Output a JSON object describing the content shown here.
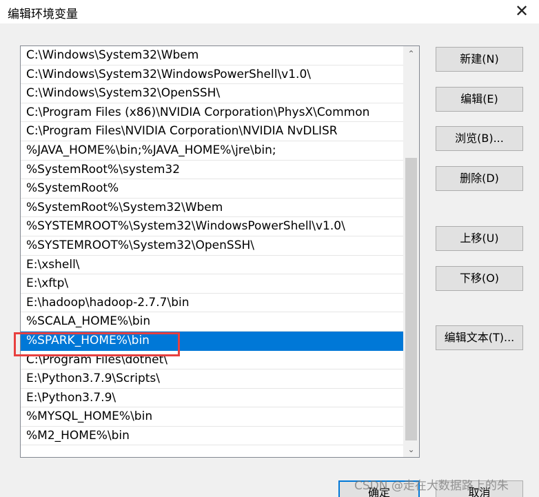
{
  "window": {
    "title": "编辑环境变量",
    "close_glyph": "✕"
  },
  "path_list": {
    "items": [
      "C:\\Windows\\System32\\Wbem",
      "C:\\Windows\\System32\\WindowsPowerShell\\v1.0\\",
      "C:\\Windows\\System32\\OpenSSH\\",
      "C:\\Program Files (x86)\\NVIDIA Corporation\\PhysX\\Common",
      "C:\\Program Files\\NVIDIA Corporation\\NVIDIA NvDLISR",
      "%JAVA_HOME%\\bin;%JAVA_HOME%\\jre\\bin;",
      "%SystemRoot%\\system32",
      "%SystemRoot%",
      "%SystemRoot%\\System32\\Wbem",
      "%SYSTEMROOT%\\System32\\WindowsPowerShell\\v1.0\\",
      "%SYSTEMROOT%\\System32\\OpenSSH\\",
      "E:\\xshell\\",
      "E:\\xftp\\",
      "E:\\hadoop\\hadoop-2.7.7\\bin",
      "%SCALA_HOME%\\bin",
      "%SPARK_HOME%\\bin",
      "C:\\Program Files\\dotnet\\",
      "E:\\Python3.7.9\\Scripts\\",
      "E:\\Python3.7.9\\",
      "%MYSQL_HOME%\\bin",
      "%M2_HOME%\\bin"
    ],
    "selected_index": 15,
    "scroll_up_glyph": "⌃",
    "scroll_down_glyph": "⌄"
  },
  "buttons": {
    "new": "新建(N)",
    "edit": "编辑(E)",
    "browse": "浏览(B)...",
    "delete": "删除(D)",
    "move_up": "上移(U)",
    "move_down": "下移(O)",
    "edit_text": "编辑文本(T)...",
    "ok": "确定",
    "cancel": "取消"
  },
  "watermark": "CSDN @走在大数据路上的朱",
  "colors": {
    "selection": "#0078d7",
    "highlight_box": "#e8403f"
  }
}
